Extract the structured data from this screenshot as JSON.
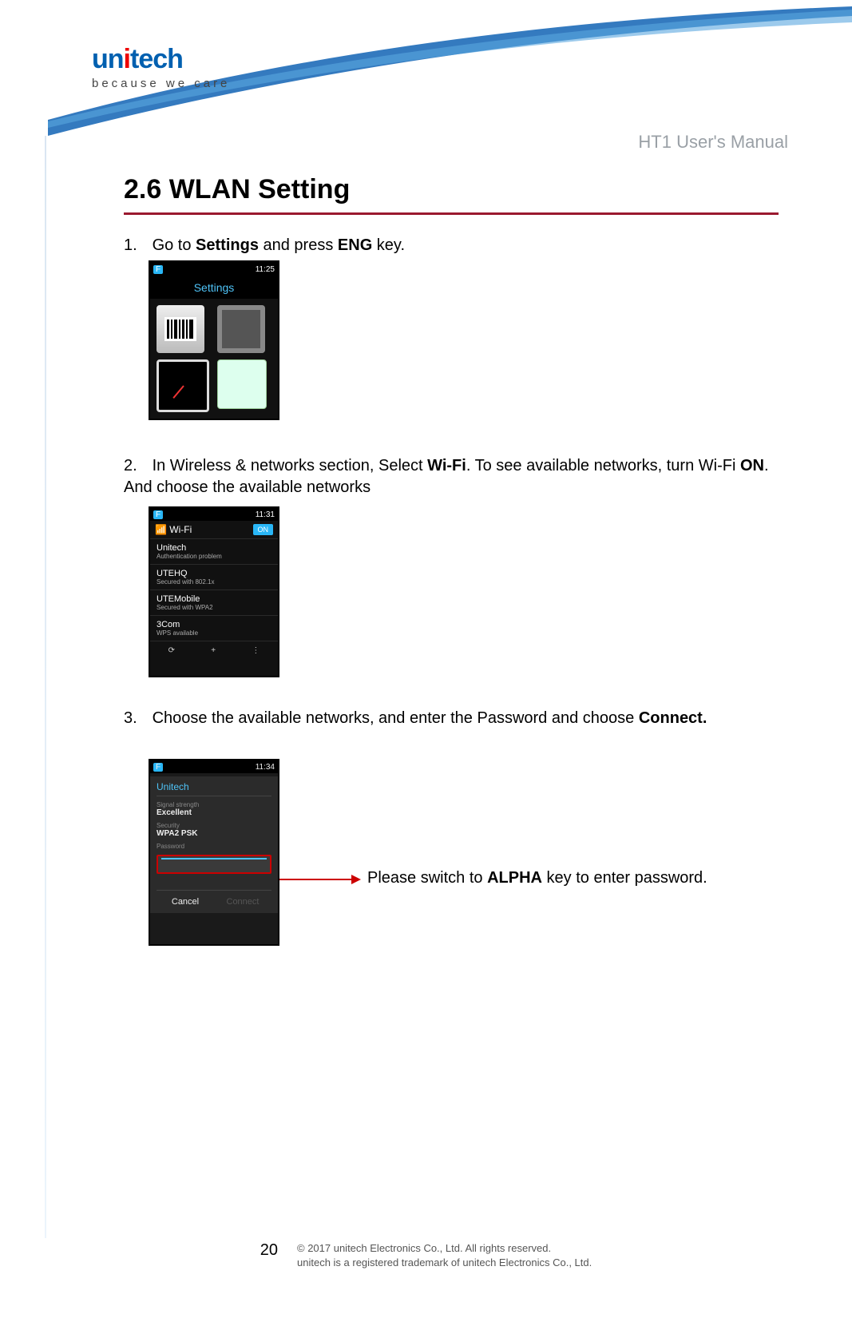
{
  "logo": {
    "text_pre": "un",
    "text_dot": "i",
    "text_post": "tech",
    "tagline": "because we care"
  },
  "manual_title": "HT1 User's Manual",
  "section_title": "2.6 WLAN Setting",
  "steps": {
    "s1": {
      "num": "1.",
      "pre": "Go to ",
      "b1": "Settings",
      "mid": " and press ",
      "b2": "ENG",
      "post": " key."
    },
    "s2": {
      "num": "2.",
      "pre": "In Wireless & networks section, Select ",
      "b1": "Wi-Fi",
      "mid1": ". To see available networks, turn Wi-Fi ",
      "b2": "ON",
      "post": ". And choose the available networks"
    },
    "s3": {
      "num": "3.",
      "pre": "Choose the available networks, and enter the Password and choose ",
      "b1": "Connect."
    }
  },
  "shot1": {
    "time": "11:25",
    "indicator": "F",
    "title": "Settings"
  },
  "shot2": {
    "time": "11:31",
    "indicator": "F",
    "header": "Wi-Fi",
    "toggle": "ON",
    "nets": [
      {
        "name": "Unitech",
        "sub": "Authentication problem"
      },
      {
        "name": "UTEHQ",
        "sub": "Secured with 802.1x"
      },
      {
        "name": "UTEMobile",
        "sub": "Secured with WPA2"
      },
      {
        "name": "3Com",
        "sub": "WPS available"
      }
    ],
    "bottom": {
      "wps": "⟳",
      "add": "+",
      "more": "⋮"
    }
  },
  "shot3": {
    "time": "11:34",
    "indicator": "F",
    "network": "Unitech",
    "signal_label": "Signal strength",
    "signal_value": "Excellent",
    "security_label": "Security",
    "security_value": "WPA2 PSK",
    "password_label": "Password",
    "cancel": "Cancel",
    "connect": "Connect"
  },
  "annotation": {
    "pre": "Please switch to ",
    "b1": "ALPHA",
    "post": " key to enter password."
  },
  "footer": {
    "page": "20",
    "line1": "© 2017 unitech Electronics Co., Ltd. All rights reserved.",
    "line2": "unitech is a registered trademark of unitech Electronics Co., Ltd."
  }
}
